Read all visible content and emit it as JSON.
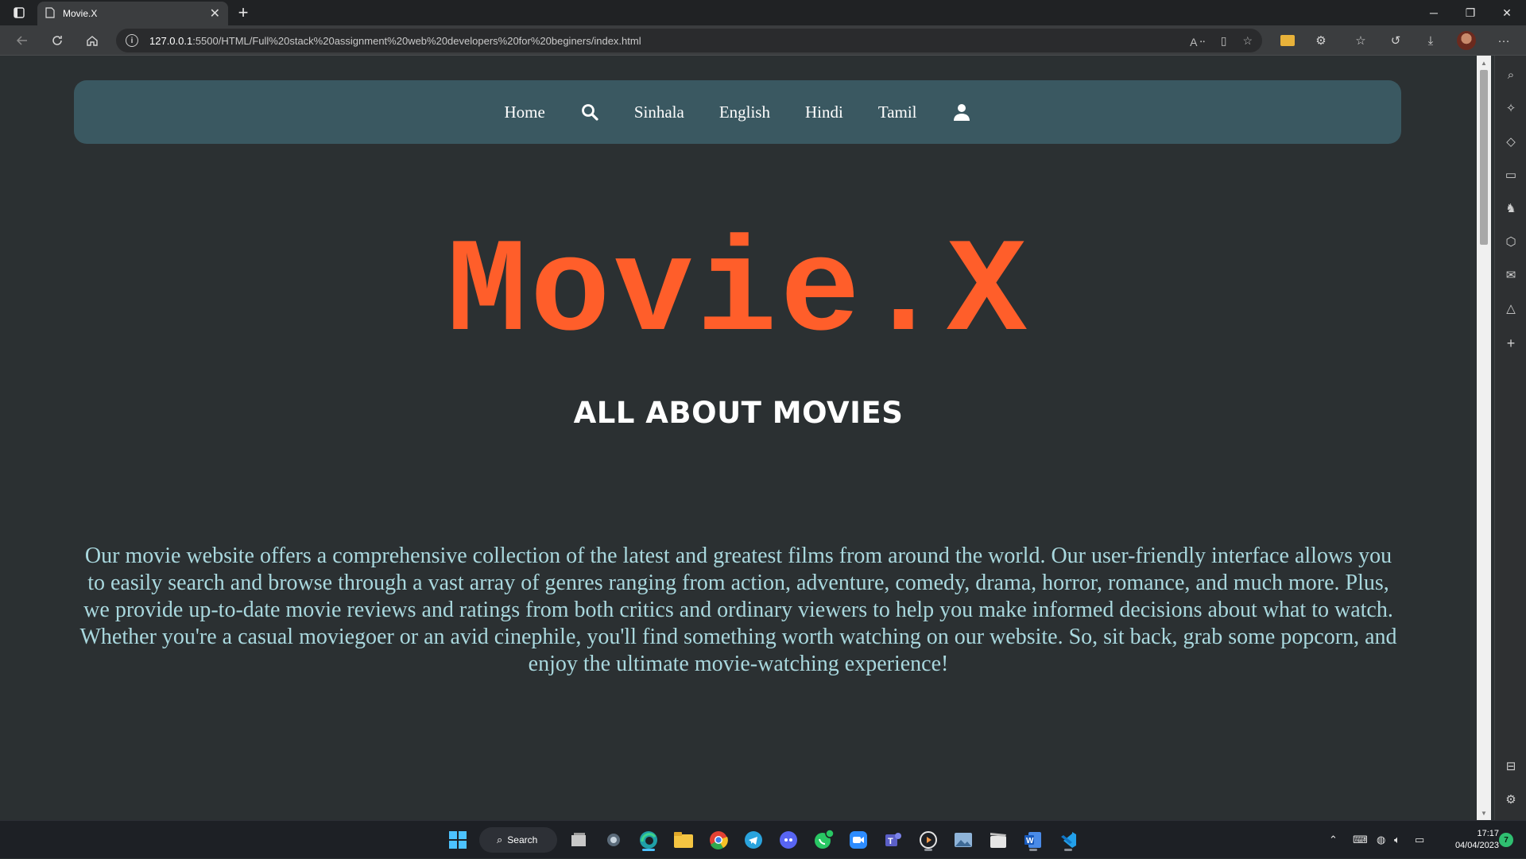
{
  "browser": {
    "tab_title": "Movie.X",
    "url_host": "127.0.0.1",
    "url_path": ":5500/HTML/Full%20stack%20assignment%20web%20developers%20for%20beginers/index.html"
  },
  "site": {
    "nav": {
      "home": "Home",
      "sinhala": "Sinhala",
      "english": "English",
      "hindi": "Hindi",
      "tamil": "Tamil"
    },
    "title": "Movie.X",
    "subtitle": "ALL ABOUT MOVIES",
    "description": "Our movie website offers a comprehensive collection of the latest and greatest films from around the world. Our user-friendly interface allows you to easily search and browse through a vast array of genres ranging from action, adventure, comedy, drama, horror, romance, and much more. Plus, we provide up-to-date movie reviews and ratings from both critics and ordinary viewers to help you make informed decisions about what to watch. Whether you're a casual moviegoer or an avid cinephile, you'll find something worth watching on our website. So, sit back, grab some popcorn, and enjoy the ultimate movie-watching experience!"
  },
  "taskbar": {
    "search_label": "Search",
    "time": "17:17",
    "date": "04/04/2023",
    "notification_count": "7"
  },
  "colors": {
    "accent_title": "#ff5e2a",
    "nav_bg": "#3a5861",
    "page_bg": "#2b3032",
    "desc_text": "#a9d8de"
  }
}
